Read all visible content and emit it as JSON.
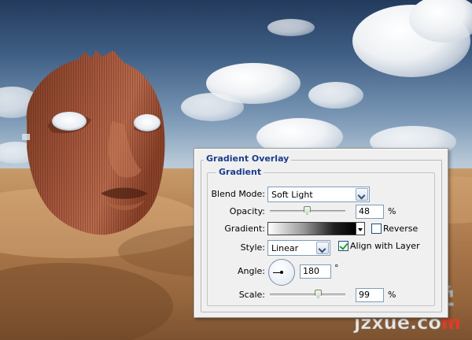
{
  "panel": {
    "title": "Gradient Overlay",
    "section": "Gradient",
    "blend_mode": {
      "label": "Blend Mode:",
      "value": "Soft Light"
    },
    "opacity": {
      "label": "Opacity:",
      "value": "48",
      "unit": "%",
      "level_percent": 48
    },
    "gradient": {
      "label": "Gradient:",
      "reverse_label": "Reverse",
      "reverse_checked": false
    },
    "style": {
      "label": "Style:",
      "value": "Linear",
      "align_label": "Align with Layer",
      "align_checked": true
    },
    "angle": {
      "label": "Angle:",
      "value": "180",
      "unit": "°"
    },
    "scale": {
      "label": "Scale:",
      "value": "99",
      "unit": "%",
      "level_percent": 99
    }
  },
  "watermark": {
    "brand_cn": "建站学",
    "url_main": "jzxue.co",
    "url_accent": "m"
  },
  "icons": [
    "angle-dial-icon",
    "dropdown-arrow-icon",
    "checkbox-icon"
  ],
  "colors": {
    "section_title": "#1b3d8c",
    "panel_bg": "#f0f0f0",
    "checkmark": "#21a121"
  }
}
